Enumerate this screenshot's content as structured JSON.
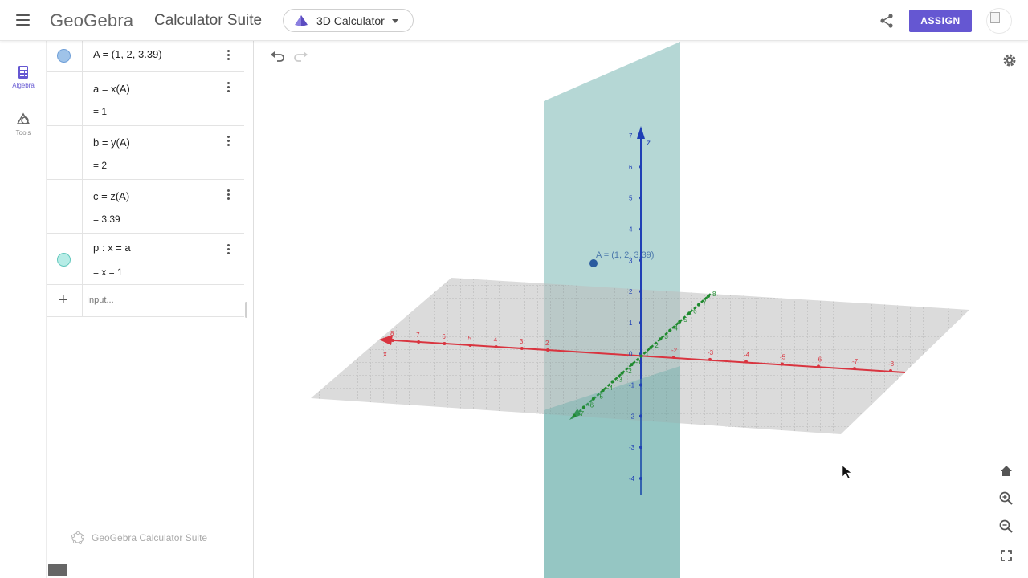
{
  "header": {
    "logo": "GeoGebra",
    "suite_title": "Calculator Suite",
    "app_picker_label": "3D Calculator",
    "assign_label": "ASSIGN"
  },
  "rail": {
    "algebra_label": "Algebra",
    "tools_label": "Tools"
  },
  "algebra": {
    "rows": [
      {
        "definition": "A = (1, 2, 3.39)",
        "value": "",
        "marble_color": "#9fc3e9"
      },
      {
        "definition": "a = x(A)",
        "value": "= 1"
      },
      {
        "definition": "b = y(A)",
        "value": "= 2"
      },
      {
        "definition": "c = z(A)",
        "value": "= 3.39"
      },
      {
        "definition": "p : x = a",
        "value": "= x = 1",
        "marble_color": "#b6ece6"
      }
    ],
    "input_placeholder": "Input...",
    "footer_label": "GeoGebra Calculator Suite"
  },
  "graphics": {
    "point_label": "A = (1, 2, 3.39)",
    "z_axis_name": "z",
    "x_axis_name": "x",
    "z_ticks": [
      "7",
      "6",
      "5",
      "4",
      "3",
      "2",
      "1",
      "0",
      "-1",
      "-2",
      "-3",
      "-4"
    ],
    "x_ticks": [
      "8",
      "7",
      "6",
      "5",
      "4",
      "3",
      "2",
      "-2",
      "-3",
      "-4",
      "-5",
      "-6",
      "-7",
      "-8"
    ],
    "y_ticks": [
      "8",
      "7",
      "6",
      "5",
      "4",
      "3",
      "2",
      "1",
      "-1",
      "-2",
      "-3",
      "-4",
      "-5",
      "-6",
      "-7"
    ],
    "colors": {
      "x_axis": "#d9343f",
      "y_axis": "#1f8a2e",
      "z_axis": "#1f3fb5",
      "plane": "#5aa7a2",
      "point": "#2a5a9e",
      "accent": "#6557d2"
    }
  }
}
